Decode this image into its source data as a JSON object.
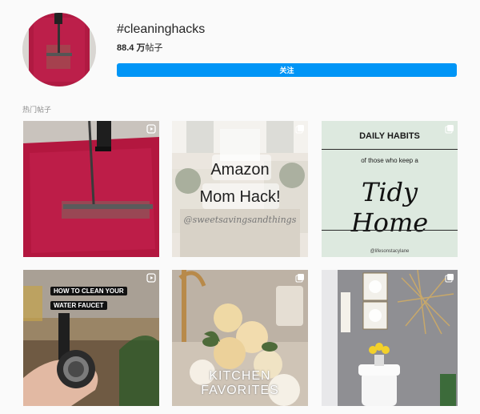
{
  "header": {
    "hashtag": "#cleaninghacks",
    "post_count": "88.4 万",
    "post_unit": "帖子",
    "follow_label": "关注"
  },
  "section": {
    "title": "热门帖子"
  },
  "posts": [
    {
      "kind": "reel",
      "subject": "red rug cleaning"
    },
    {
      "kind": "carousel",
      "overlay_title": "Amazon",
      "overlay_subtitle": "Mom Hack!",
      "overlay_handle": "@sweetsavingsandthings"
    },
    {
      "kind": "carousel",
      "heading": "DAILY HABITS",
      "subheading": "of those who keep a",
      "script_text": "Tidy Home",
      "handle": "@lifesonstacylane"
    },
    {
      "kind": "reel",
      "caption_line1": "HOW TO CLEAN YOUR",
      "caption_line2": "WATER FAUCET"
    },
    {
      "kind": "carousel",
      "caption_line1": "KITCHEN",
      "caption_line2": "FAVORITES"
    },
    {
      "kind": "carousel",
      "subject": "bathroom decor"
    }
  ],
  "colors": {
    "accent": "#0095f6",
    "rug": "#b3173f",
    "mint": "#dde9df"
  }
}
